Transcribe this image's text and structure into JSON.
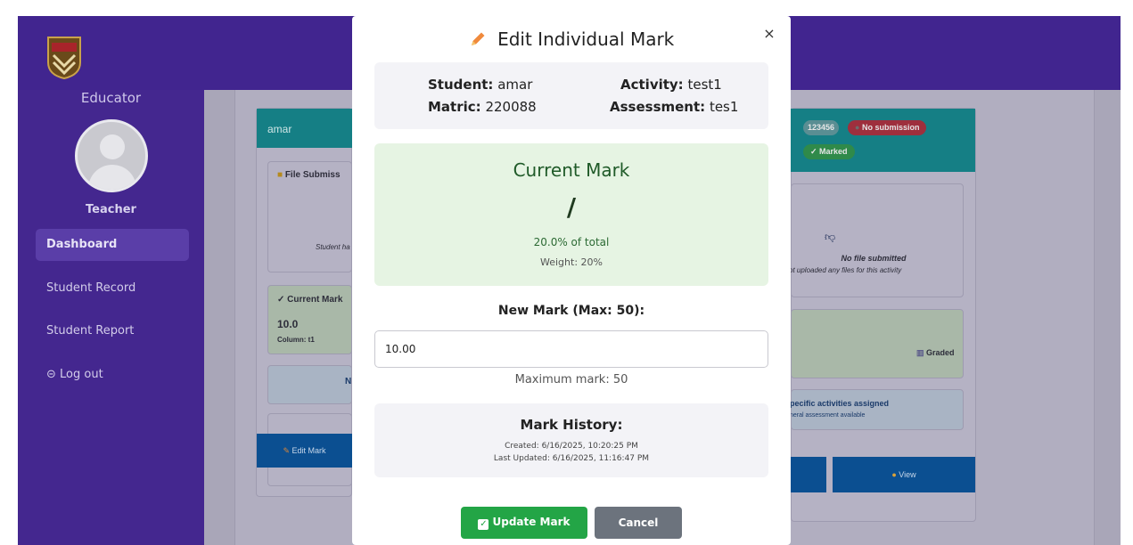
{
  "sidebar": {
    "title": "Educator",
    "role": "Teacher",
    "items": [
      {
        "label": "Dashboard",
        "active": true
      },
      {
        "label": "Student Record"
      },
      {
        "label": "Student Report"
      },
      {
        "label": "Log out"
      }
    ],
    "logout_icon": "logout-icon"
  },
  "background_card": {
    "student_name": "amar",
    "file_submission": "File Submiss",
    "student_note": "Student ha",
    "current_mark_label": "✓ Current Mark",
    "current_mark_value": "10.0",
    "column_label": "Column: t1",
    "partial_n": "N",
    "edit_mark_label": "Edit Mark",
    "badge_id": "123456",
    "badge_no_submission": "No submission",
    "badge_marked": "✓ Marked",
    "no_file": "No file submitted",
    "no_file_sub": "ot uploaded any files for this activity",
    "graded": "Graded",
    "specific_line1": "pecific activities assigned",
    "specific_line2": "neral assessment available",
    "view_label": "View"
  },
  "modal": {
    "title": "Edit Individual Mark",
    "close_label": "×",
    "student_label": "Student:",
    "student_value": "amar",
    "activity_label": "Activity:",
    "activity_value": "test1",
    "matric_label": "Matric:",
    "matric_value": "220088",
    "assessment_label": "Assessment:",
    "assessment_value": "tes1",
    "current_mark_title": "Current Mark",
    "current_mark_value": "/",
    "percent_of_total": "20.0% of total",
    "weight": "Weight: 20%",
    "new_mark_label": "New Mark (Max: 50):",
    "new_mark_value": "10.00",
    "max_note": "Maximum mark: 50",
    "history_title": "Mark History:",
    "history_created": "Created: 6/16/2025, 10:20:25 PM",
    "history_updated": "Last Updated: 6/16/2025, 11:16:47 PM",
    "update_button": "Update Mark",
    "cancel_button": "Cancel"
  },
  "colors": {
    "sidebar": "#44278f",
    "update_green": "#23a546",
    "cancel_gray": "#6c737d",
    "mark_green_bg": "#e6f4e3"
  }
}
